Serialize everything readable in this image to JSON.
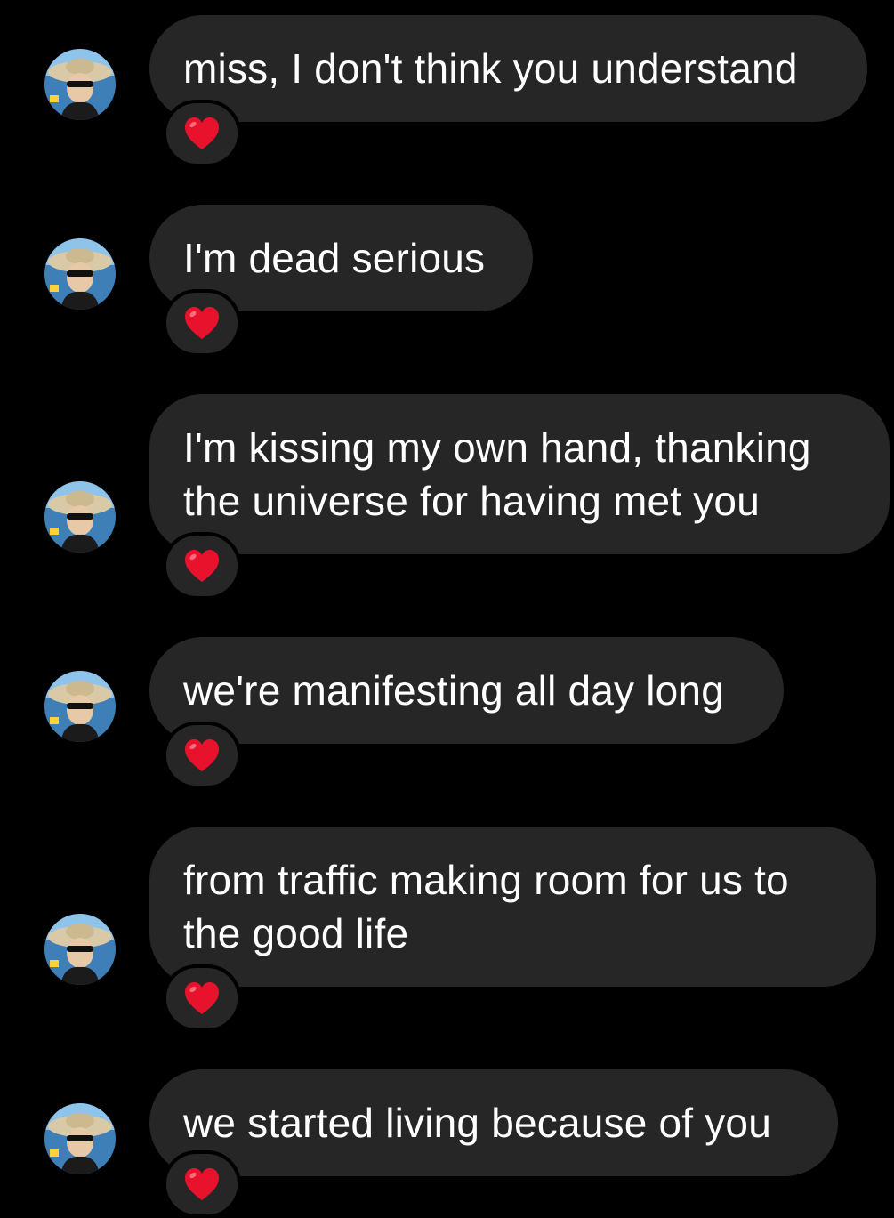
{
  "colors": {
    "background": "#000000",
    "bubble": "#262626",
    "text": "#ffffff",
    "heart": "#e8122d"
  },
  "messages": [
    {
      "text": "miss, I don't think you understand",
      "reaction": "red-heart-icon"
    },
    {
      "text": "I'm dead serious",
      "reaction": "red-heart-icon"
    },
    {
      "text": "I'm kissing my own hand, thanking\nthe universe for having met you",
      "reaction": "red-heart-icon"
    },
    {
      "text": "we're manifesting all day long",
      "reaction": "red-heart-icon"
    },
    {
      "text": "from traffic making room for us to\nthe good life",
      "reaction": "red-heart-icon"
    },
    {
      "text": "we started living because of you",
      "reaction": "red-heart-icon"
    }
  ]
}
